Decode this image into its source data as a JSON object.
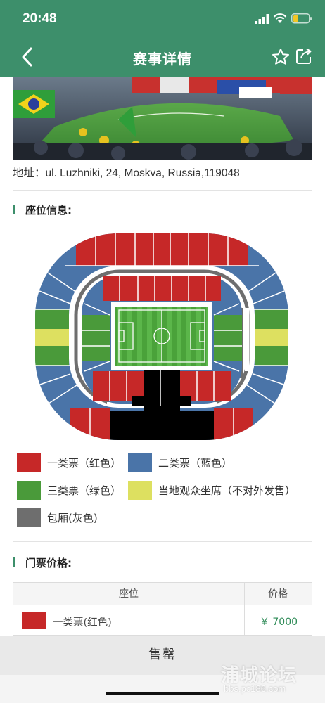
{
  "status_bar": {
    "time": "20:48"
  },
  "nav": {
    "title": "赛事详情",
    "back_icon": "chevron-left-icon",
    "favorite_icon": "star-icon",
    "share_icon": "share-icon"
  },
  "venue": {
    "address": "地址：ul. Luzhniki, 24, Moskva, Russia,119048"
  },
  "seats_section": {
    "title": "座位信息:",
    "legend": [
      {
        "label": "一类票（红色）",
        "color": "#c62828"
      },
      {
        "label": "二类票（蓝色）",
        "color": "#4a74a8"
      },
      {
        "label": "三类票（绿色）",
        "color": "#4a9a3a"
      },
      {
        "label": "当地观众坐席（不对外发售）",
        "color": "#dde060"
      },
      {
        "label": "包厢(灰色)",
        "color": "#6e6e6e"
      }
    ]
  },
  "price_section": {
    "title": "门票价格:",
    "columns": [
      "座位",
      "价格"
    ],
    "rows": [
      {
        "seat": "一类票(红色)",
        "price": "￥ 7000",
        "color": "#c62828"
      }
    ]
  },
  "action": {
    "label": "售罄"
  },
  "watermark": {
    "main": "浦城论坛",
    "sub": "bbs.pc186.com"
  },
  "colors": {
    "accent": "#3d8f6b",
    "price_text": "#2e8b57"
  }
}
